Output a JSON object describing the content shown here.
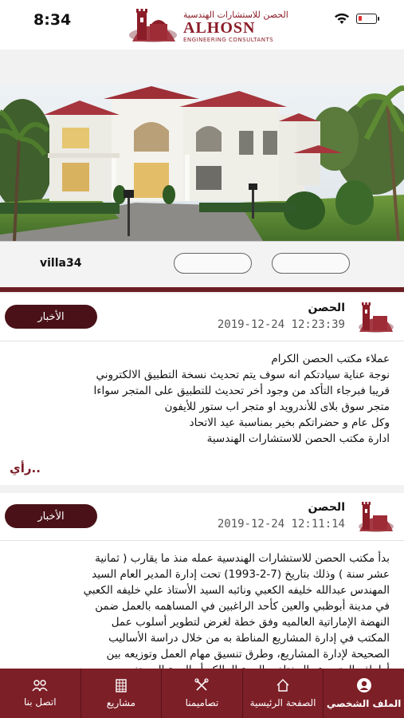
{
  "status_bar": {
    "time": "8:34"
  },
  "header": {
    "logo_arabic": "الحصن للاستشارات الهندسية",
    "logo_english": "ALHOSN",
    "logo_subtitle": "ENGINEERING CONSULTANTS"
  },
  "villa": {
    "title": "villa34"
  },
  "posts": [
    {
      "author": "الحصن",
      "date": "2019-12-24 12:23:39",
      "tag_label": "الأخبار",
      "lines": [
        "عملاء مكتب الحصن الكرام",
        "نوجة عناية سيادتكم انه سوف يتم تحديث نسخة التطبيق الالكتروني",
        "قريبا فبرجاء التأكد من وجود أخر تحديث للتطبيق على المتجر سواءا",
        "متجر سوق بلاى للأندرويد او متجر اب ستور للأيفون",
        "وكل عام و حضراتكم بخير بمناسبة عيد الاتحاد",
        "ادارة مكتب الحصن للاستشارات الهندسية"
      ],
      "more_label": "رأي.."
    },
    {
      "author": "الحصن",
      "date": "2019-12-24 12:11:14",
      "tag_label": "الأخبار",
      "lines": [
        "بدأ مكتب الحصن للاستشارات الهندسية عمله منذ ما يقارب ( ثمانية",
        "عشر سنة ) وذلك بتاريخ (7-2-1993) تحت إدارة المدير العام السيد",
        "المهندس عبدالله خليفه الكعبي ونائبه السيد الأستاذ علي خليفه الكعبي",
        "في مدينة أبوظبي والعين كأحد الراغبين في المساهمه بالعمل ضمن",
        "النهضة الإماراتية العالميه وفق خطة لغرض لتطوير أسلوب عمل",
        "المكتب في إدارة المشاريع المناطة به من خلال دراسة الأساليب",
        "الصحيحة لإدارة المشاريع، وطرق تنسيق مهام العمل وتوزيعه بين",
        "أطرافه المتعددة والمختلفه، الجهة المالكه أو الجهة المستفيده"
      ]
    }
  ],
  "bottom_nav": [
    {
      "label": "اتصل بنا",
      "icon": "people-icon"
    },
    {
      "label": "مشاريع",
      "icon": "building-icon"
    },
    {
      "label": "تصاميمنا",
      "icon": "tools-icon"
    },
    {
      "label": "الصفحة الرئيسية",
      "icon": "home-icon"
    },
    {
      "label": "الملف الشخصي",
      "icon": "user-icon"
    }
  ],
  "colors": {
    "brand": "#7d1f27",
    "brand_dark": "#4a1218"
  }
}
